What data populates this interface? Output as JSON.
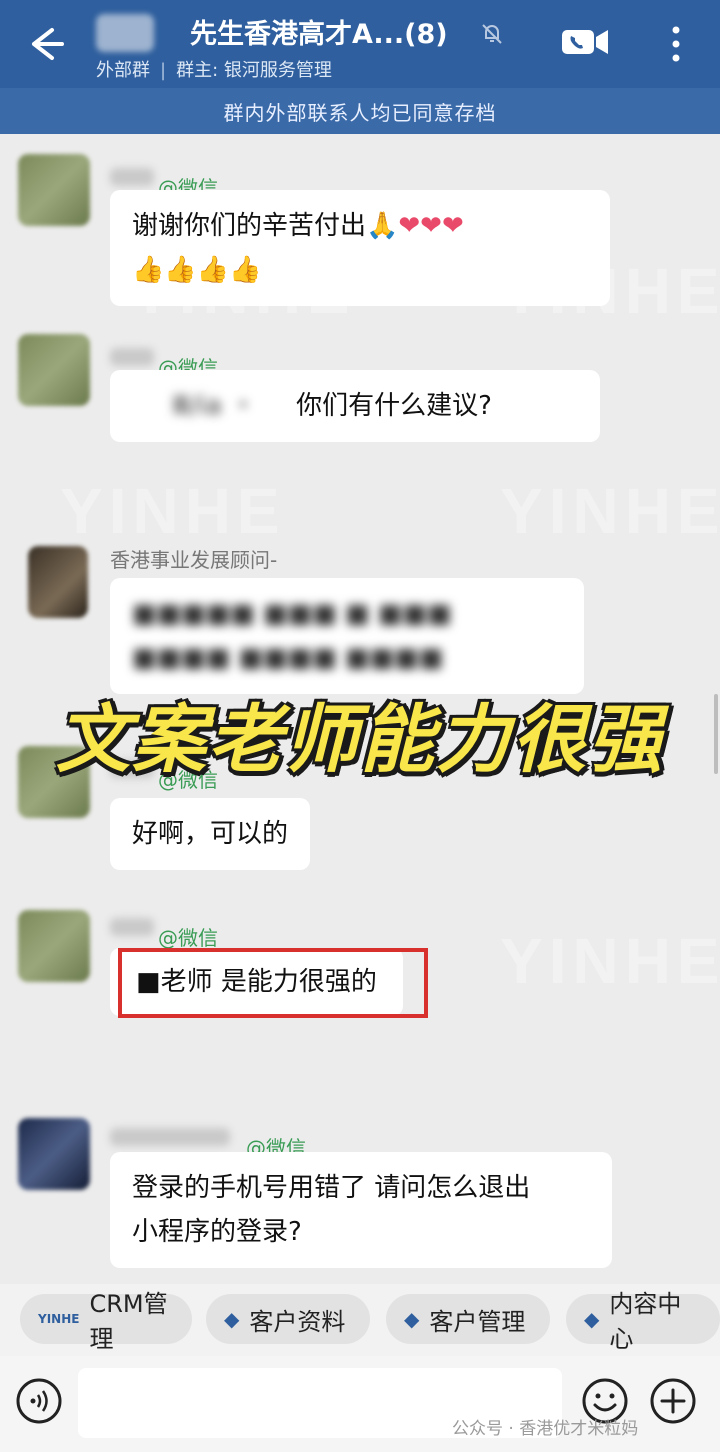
{
  "header": {
    "title": "先生香港高才A...(8)",
    "group_type": "外部群",
    "group_owner": "群主: 银河服务管理",
    "archive_notice": "群内外部联系人均已同意存档"
  },
  "messages": [
    {
      "sender_tag": "@微信",
      "text": "谢谢你们的辛苦付出",
      "emoji_line1": "🙏❤❤❤",
      "emoji_line2": "👍👍👍👍"
    },
    {
      "sender_tag": "@微信",
      "blurred": "Ⅲ/ia ・",
      "text": "你们有什么建议?"
    },
    {
      "sender_name": "香港事业发展顾问-",
      "blurred_line1": "■■■■■ ■■■ ■ ■■■",
      "blurred_line2": "■■■■ ■■■■ ■■■■"
    },
    {
      "sender_tag": "@微信",
      "text": "好啊，可以的"
    },
    {
      "sender_tag": "@微信",
      "text": "■老师 是能力很强的"
    },
    {
      "sender_tag": "@微信",
      "text_line1": "登录的手机号用错了 请问怎么退出",
      "text_line2": "小程序的登录?"
    }
  ],
  "caption": "文案老师能力很强",
  "watermark": "YINHE",
  "quick_actions": [
    {
      "label": "CRM管理",
      "icon": "yinhe-logo-icon"
    },
    {
      "label": "客户资料",
      "icon": "diamond-icon"
    },
    {
      "label": "客户管理",
      "icon": "diamond-icon"
    },
    {
      "label": "内容中心",
      "icon": "diamond-icon"
    }
  ],
  "footer": {
    "source": "公众号 · 香港优才米粒妈"
  }
}
